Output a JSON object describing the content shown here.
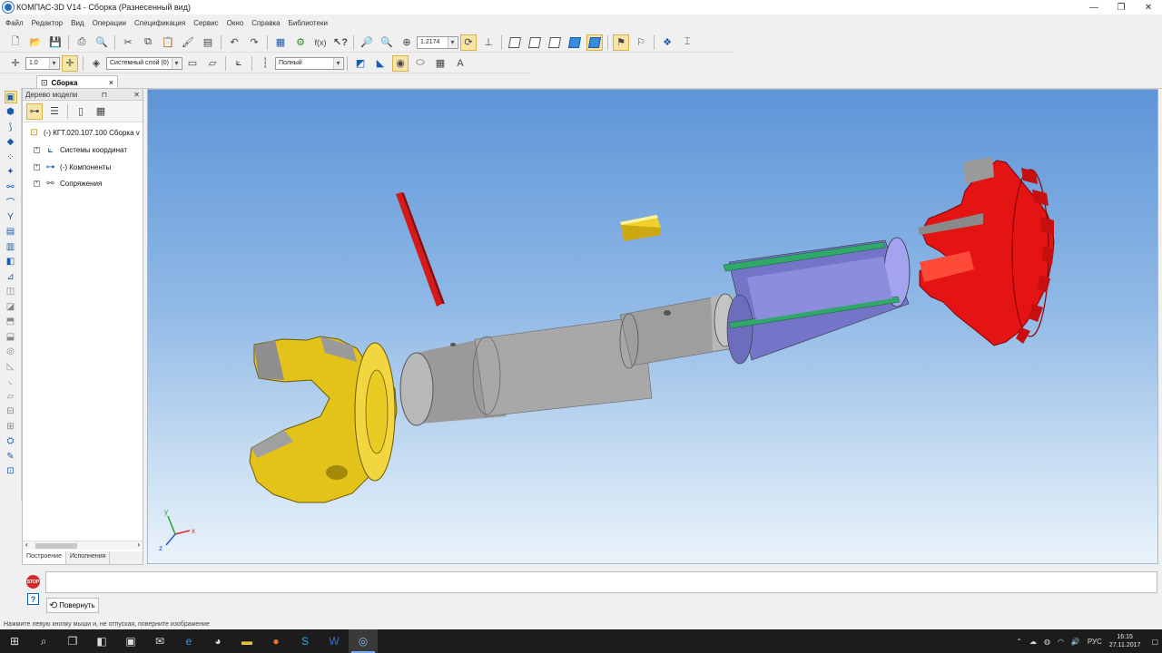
{
  "window": {
    "title": "КОМПАС-3D V14 - Сборка (Разнесенный вид)",
    "controls": [
      "—",
      "❐",
      "✕"
    ]
  },
  "menu": [
    "Файл",
    "Редактор",
    "Вид",
    "Операции",
    "Спецификация",
    "Сервис",
    "Окно",
    "Справка",
    "Библиотеки"
  ],
  "toolbar": {
    "zoom_value": "1.2174",
    "scale_value": "1.0",
    "layer_value": "Системный слой (0)",
    "line_style_value": "Полный"
  },
  "document_tab": {
    "label": "Сборка",
    "close": "×"
  },
  "model_tree": {
    "header": "Дерево модели",
    "pin": "⊓",
    "close": "✕",
    "root": "(-) КГТ.020.107.100 Сборка v",
    "items": [
      {
        "label": "Системы координат"
      },
      {
        "label": "(-) Компоненты"
      },
      {
        "label": "Сопряжения"
      }
    ],
    "tabs": [
      "Построение",
      "Исполнения"
    ]
  },
  "triad": {
    "x": "x",
    "y": "y",
    "z": "z"
  },
  "status": {
    "stop": "STOP",
    "help": "?",
    "rotate_button": "Повернуть"
  },
  "hint": "Нажмите левую кнопку мыши и, не отпуская, поверните изображение",
  "tray": {
    "language": "РУС",
    "time": "16:15",
    "date": "27.11.2017"
  },
  "colors": {
    "viewport_top": "#5e95d8",
    "part_yellow": "#e3c319",
    "part_gray": "#a0a0a0",
    "part_blue": "#8a8ae0",
    "part_green": "#2fa86a",
    "part_red": "#e51414"
  }
}
